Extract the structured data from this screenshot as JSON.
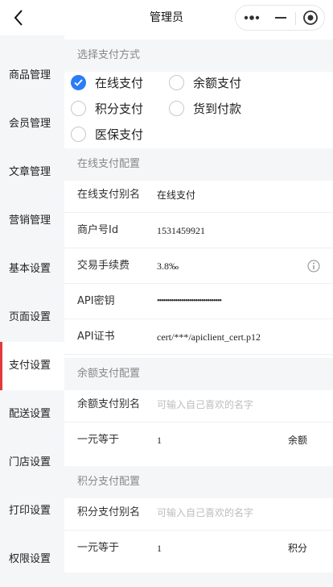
{
  "nav": {
    "title": "管理员"
  },
  "sidebar": {
    "items": [
      {
        "label": "商品管理"
      },
      {
        "label": "会员管理"
      },
      {
        "label": "文章管理"
      },
      {
        "label": "营销管理"
      },
      {
        "label": "基本设置"
      },
      {
        "label": "页面设置"
      },
      {
        "label": "支付设置"
      },
      {
        "label": "配送设置"
      },
      {
        "label": "门店设置"
      },
      {
        "label": "打印设置"
      },
      {
        "label": "权限设置"
      }
    ]
  },
  "pay_methods": {
    "header": "选择支付方式",
    "options": [
      {
        "label": "在线支付",
        "checked": true
      },
      {
        "label": "余额支付",
        "checked": false
      },
      {
        "label": "积分支付",
        "checked": false
      },
      {
        "label": "货到付款",
        "checked": false
      },
      {
        "label": "医保支付",
        "checked": false
      }
    ]
  },
  "online": {
    "header": "在线支付配置",
    "alias_label": "在线支付别名",
    "alias_value": "在线支付",
    "merchant_label": "商户号Id",
    "merchant_value": "1531459921",
    "fee_label": "交易手续费",
    "fee_value": "3.8‰",
    "key_label": "API密钥",
    "key_value": "••••••••••••••••••••••••••••••••",
    "cert_label": "API证书",
    "cert_value": "cert/***/apiclient_cert.p12"
  },
  "balance": {
    "header": "余额支付配置",
    "alias_label": "余额支付别名",
    "alias_placeholder": "可输入自己喜欢的名字",
    "rate_label": "一元等于",
    "rate_value": "1",
    "rate_unit": "余额"
  },
  "points": {
    "header": "积分支付配置",
    "alias_label": "积分支付别名",
    "alias_placeholder": "可输入自己喜欢的名字",
    "rate_label": "一元等于",
    "rate_value": "1",
    "rate_unit": "积分"
  },
  "colors": {
    "accent": "#2b7cf6",
    "active_marker": "#e4393c",
    "section_bg": "#f5f6f8"
  }
}
